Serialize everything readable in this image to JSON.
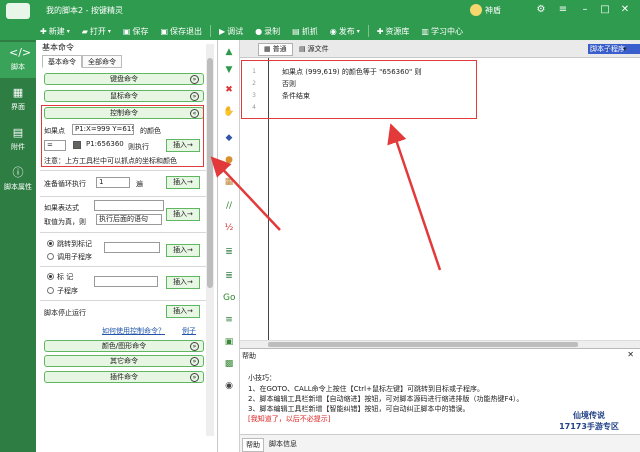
{
  "app": {
    "title": "我的脚本2 - 按键精灵",
    "user": "神盾"
  },
  "toolbar": {
    "new": "新建",
    "open": "打开",
    "save": "保存",
    "save_exit": "保存退出",
    "debug": "调试",
    "record": "录制",
    "capture": "抓抓",
    "publish": "发布",
    "resource": "资源库",
    "learn": "学习中心"
  },
  "leftnav": {
    "script": "脚本",
    "ui": "界面",
    "attach": "附件",
    "props": "脚本属性"
  },
  "panel": {
    "title": "基本命令",
    "tab_basic": "基本命令",
    "tab_all": "全部命令",
    "sec_keyboard": "键盘命令",
    "sec_mouse": "鼠标命令",
    "sec_control": "控制命令",
    "if_point_label": "如果点",
    "if_point_value": "P1:X=999 Y=619",
    "color_of": "的颜色",
    "op": "=",
    "color_value": "P1:656360",
    "then_exec": "则执行",
    "insert": "插入→",
    "note": "注意：上方工具栏中可以抓点的坐标和颜色",
    "loop_label": "准备循环执行",
    "loop_value": "1",
    "loop_unit": "遍",
    "if_expr_label": "如果表达式",
    "if_true_label": "取值为真，则",
    "if_true_value": "执行后面的语句",
    "jump_label": "跳转到标记",
    "call_label": "调用子程序",
    "mark_label": "标 记",
    "sub_label": "子程序",
    "stop_label": "脚本停止运行",
    "how_link": "如何使用控制命令？",
    "example_link": "例子",
    "sec_color": "颜色/图形命令",
    "sec_other": "其它命令",
    "sec_plugin": "插件命令"
  },
  "editor": {
    "tab_normal": "普通",
    "tab_source": "源文件",
    "cmd_select": "脚本子程序",
    "lines": [
      {
        "num": "1",
        "text": "如果点 (999,619) 的颜色等于 \"656360\" 则"
      },
      {
        "num": "2",
        "text": "否则"
      },
      {
        "num": "3",
        "text": "条件结束"
      },
      {
        "num": "4",
        "text": ""
      }
    ]
  },
  "help": {
    "title": "帮助",
    "tip": "小技巧：",
    "l1": "1、在GOTO、CALL命令上按住【Ctrl+鼠标左键】可跳转到目标或子程序。",
    "l2": "2、脚本编辑工具栏新增【自动缩进】按钮，可对脚本源码进行缩进排版（功能热键F4）。",
    "l3": "3、脚本编辑工具栏新增【智能纠错】按钮，可自动纠正脚本中的错误。",
    "close_tip": "[我知道了，以后不必提示]",
    "tab_help": "帮助",
    "tab_info": "脚本信息"
  },
  "watermark": {
    "line1": "仙境传说",
    "line2": "17173手游专区"
  },
  "colors": {
    "brand": "#2f9b4f",
    "annotation": "#e23a3a"
  }
}
